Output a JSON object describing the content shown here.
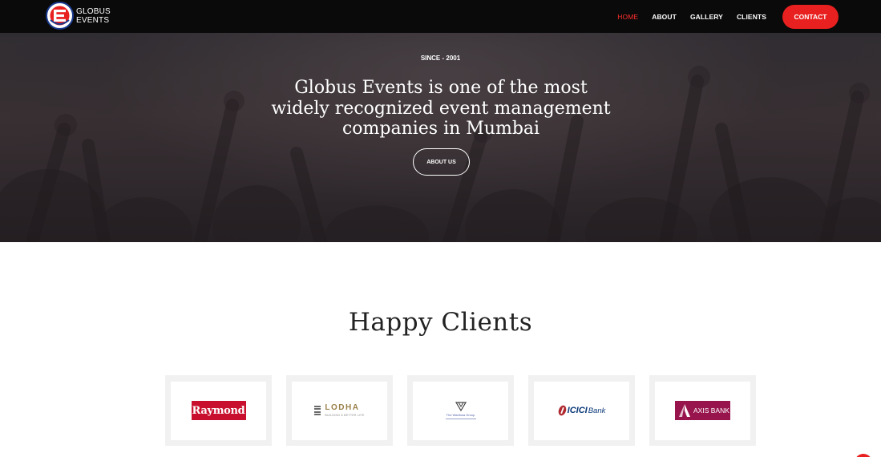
{
  "brand": {
    "logo_letter": "E",
    "name_line1": "GLOBUS",
    "name_line2": "EVENTS"
  },
  "nav": {
    "items": [
      {
        "label": "HOME",
        "active": true
      },
      {
        "label": "ABOUT",
        "active": false
      },
      {
        "label": "GALLERY",
        "active": false
      },
      {
        "label": "CLIENTS",
        "active": false
      }
    ],
    "contact_label": "CONTACT"
  },
  "hero": {
    "eyebrow": "SINCE - 2001",
    "headline": "Globus Events is one of the most widely recognized event management companies in Mumbai",
    "cta_label": "ABOUT US"
  },
  "clients": {
    "title": "Happy Clients",
    "logos": {
      "raymond": "Raymond",
      "lodha": "LODHA",
      "lodha_tagline": "BUILDING A BETTER LIFE",
      "wadhwa": "The Wadhwa Group",
      "icici": "ICICI",
      "icici_bank": "Bank",
      "axis": "AXIS BANK"
    }
  },
  "colors": {
    "accent": "#e8201f",
    "nav_active": "#ff2e2e",
    "navbar_bg": "#0a0a0a",
    "raymond_red": "#c8102e",
    "axis_maroon": "#97144d",
    "icici_blue": "#0b3a7a",
    "lodha_gold": "#9a8048"
  }
}
